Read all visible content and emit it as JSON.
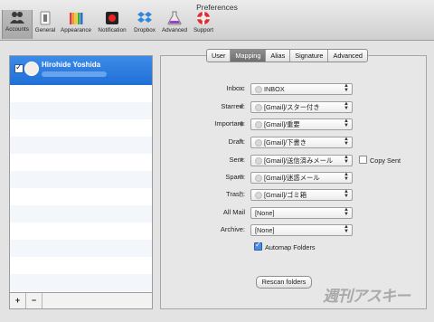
{
  "window": {
    "title": "Preferences"
  },
  "toolbar": {
    "items": [
      {
        "label": "Accounts",
        "selected": true,
        "icon": "accounts-icon"
      },
      {
        "label": "General",
        "icon": "general-icon"
      },
      {
        "label": "Appearance",
        "icon": "appearance-icon"
      },
      {
        "label": "Notification",
        "icon": "notification-icon"
      },
      {
        "label": "Dropbox",
        "icon": "dropbox-icon"
      },
      {
        "label": "Advanced",
        "icon": "advanced-icon"
      },
      {
        "label": "Support",
        "icon": "support-icon"
      }
    ]
  },
  "accounts": {
    "list": [
      {
        "name": "Hirohide Yoshida",
        "checked": true
      }
    ],
    "add_label": "+",
    "remove_label": "−"
  },
  "tabs": [
    {
      "label": "User"
    },
    {
      "label": "Mapping",
      "selected": true
    },
    {
      "label": "Alias"
    },
    {
      "label": "Signature"
    },
    {
      "label": "Advanced"
    }
  ],
  "mapping": {
    "rows": [
      {
        "label": "Inbox:",
        "icon": "inbox-icon",
        "value": "INBOX"
      },
      {
        "label": "Starred:",
        "icon": "star-icon",
        "value": "[Gmail]/スター付き"
      },
      {
        "label": "Important:",
        "icon": "tag-icon",
        "value": "[Gmail]/重要"
      },
      {
        "label": "Draft:",
        "icon": "pencil-icon",
        "value": "[Gmail]/下書き"
      },
      {
        "label": "Sent:",
        "icon": "paper-plane-icon",
        "value": "[Gmail]/送信済みメール"
      },
      {
        "label": "Spam:",
        "icon": "spam-icon",
        "value": "[Gmail]/迷惑メール"
      },
      {
        "label": "Trash:",
        "icon": "trash-icon",
        "value": "[Gmail]/ゴミ箱"
      },
      {
        "label": "All Mail",
        "icon": "",
        "value": "[None]"
      },
      {
        "label": "Archive:",
        "icon": "",
        "value": "[None]"
      }
    ],
    "copy_sent_label": "Copy Sent",
    "automap_label": "Automap Folders",
    "automap_checked": true,
    "rescan_label": "Rescan folders"
  },
  "watermark": "週刊アスキー",
  "colors": {
    "accent": "#2a79e0",
    "selection": "#1f6fd6"
  }
}
